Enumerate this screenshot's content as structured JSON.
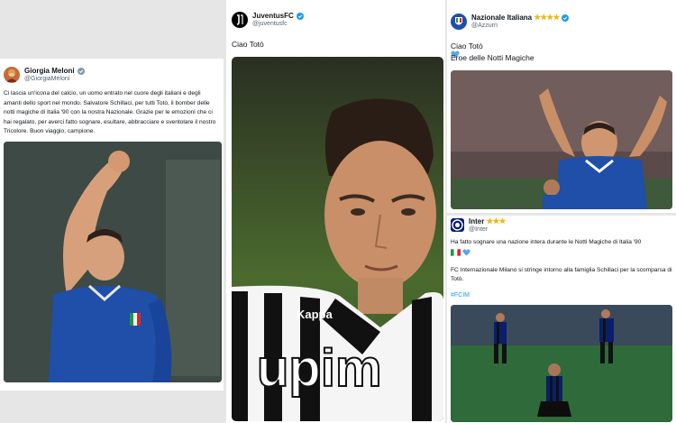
{
  "meloni": {
    "name": "Giorgia Meloni",
    "handle": "@GiorgiaMeloni",
    "text": "Ci lascia un'icona del calcio, un uomo entrato nel cuore degli italiani e degli amanti dello sport nel mondo. Salvatore Schillaci, per tutti Totò, il bomber delle notti magiche di Italia '90 con la nostra Nazionale. Grazie per le emozioni che ci hai regalato, per averci fatto sognare, esultare, abbracciare e sventolare il nostro Tricolore. Buon viaggio, campione."
  },
  "juventus": {
    "name": "JuventusFC",
    "handle": "@juventusfc",
    "text": "Ciao Totò",
    "shirt_text": "upim",
    "shirt_brand": "Kappa"
  },
  "nazionale": {
    "name": "Nazionale Italiana",
    "stars": "★★★★",
    "handle": "@Azzurri",
    "line1": "Ciao Totò",
    "line2": "Eroe delle Notti Magiche"
  },
  "inter": {
    "name": "Inter",
    "stars": "★★★",
    "handle": "@Inter",
    "line1": "Ha fatto sognare una nazione intera durante le Notti Magiche di Italia '90",
    "line2": "FC Internazionale Milano si stringe intorno alla famiglia Schillaci per la scomparsa di Totò.",
    "hashtag": "#FCIM"
  },
  "colors": {
    "verified_blue": "#1d9bf0",
    "azzurri_blue": "#1f4fa8",
    "inter_blue": "#0a1f6b",
    "star_gold": "#e8b923",
    "heart_blue": "#5aa5e8"
  }
}
